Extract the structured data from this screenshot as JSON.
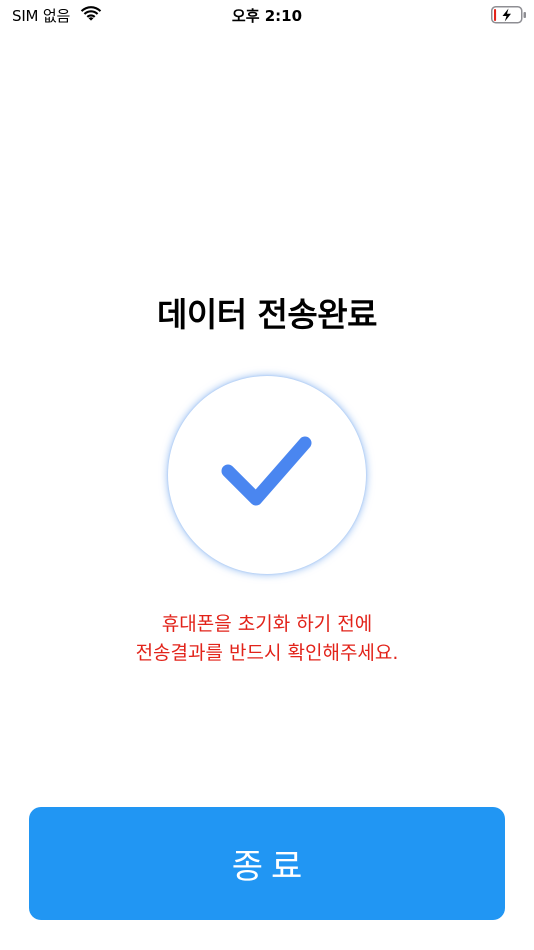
{
  "status_bar": {
    "carrier": "SIM 없음",
    "time": "오후 2:10",
    "wifi_icon": "wifi-icon",
    "battery_icon": "battery-charging-icon",
    "battery_level": 0.08,
    "battery_color": "#e2231a"
  },
  "main": {
    "title": "데이터 전송완료",
    "check_icon": "checkmark-icon",
    "check_color": "#4a86f0",
    "notice_line1": "휴대폰을 초기화 하기 전에",
    "notice_line2": "전송결과를 반드시 확인해주세요.",
    "notice_color": "#e2231a"
  },
  "footer": {
    "exit_label": "종료",
    "button_color": "#2196f3"
  }
}
